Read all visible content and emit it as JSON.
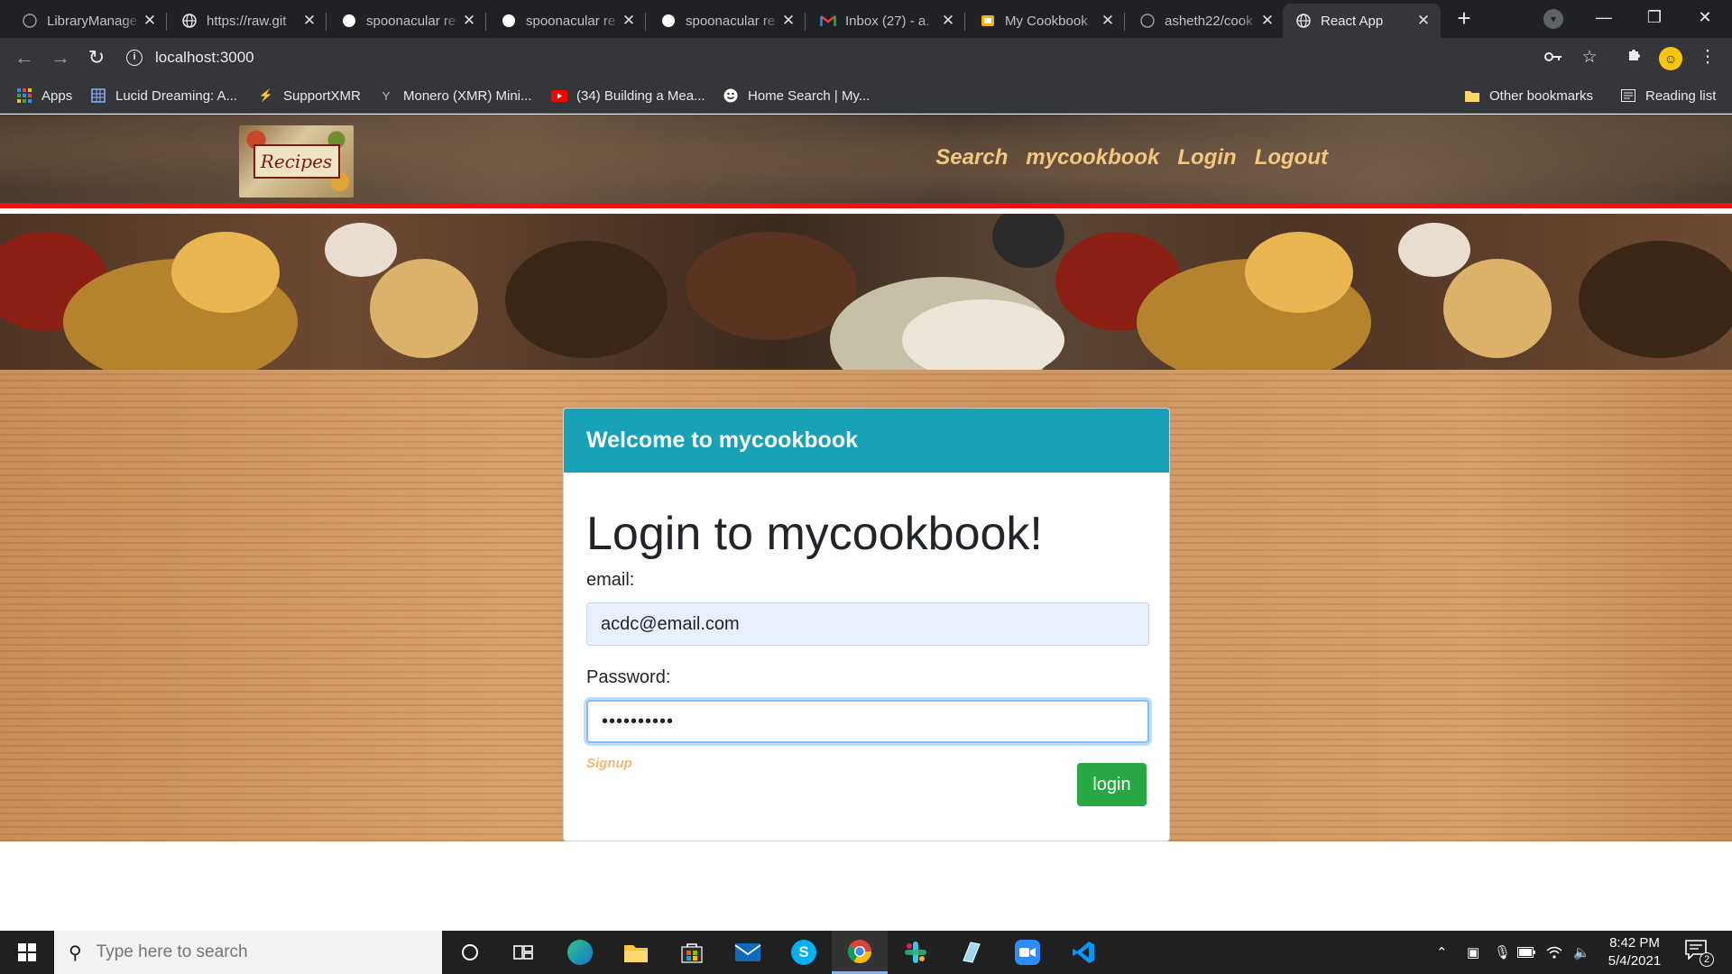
{
  "browser": {
    "tabs": [
      {
        "title": "LibraryManage",
        "icon": "github-icon"
      },
      {
        "title": "https://raw.git",
        "icon": "globe-icon"
      },
      {
        "title": "spoonacular re",
        "icon": "spoonacular-icon"
      },
      {
        "title": "spoonacular re",
        "icon": "spoonacular-icon"
      },
      {
        "title": "spoonacular re",
        "icon": "spoonacular-icon"
      },
      {
        "title": "Inbox (27) - a.",
        "icon": "gmail-icon"
      },
      {
        "title": "My Cookbook",
        "icon": "slides-icon"
      },
      {
        "title": "asheth22/cook",
        "icon": "github-icon"
      },
      {
        "title": "React App",
        "icon": "globe-icon",
        "active": true
      }
    ],
    "url": "localhost:3000",
    "bookmarks": [
      {
        "label": "Apps",
        "icon": "apps-grid-icon"
      },
      {
        "label": "Lucid Dreaming: A...",
        "icon": "grid-icon"
      },
      {
        "label": "SupportXMR",
        "icon": "bolt-icon"
      },
      {
        "label": "Monero (XMR) Mini...",
        "icon": "glass-icon"
      },
      {
        "label": "(34) Building a Mea...",
        "icon": "youtube-icon"
      },
      {
        "label": "Home Search | My...",
        "icon": "smiley-icon"
      }
    ],
    "other_bookmarks": "Other bookmarks",
    "reading_list": "Reading list"
  },
  "site": {
    "logo_text": "Recipes",
    "nav": [
      "Search",
      "mycookbook",
      "Login",
      "Logout"
    ]
  },
  "login_card": {
    "header": "Welcome to mycookbook",
    "title": "Login to mycookbook!",
    "email_label": "email:",
    "email_value": "acdc@email.com",
    "password_label": "Password:",
    "password_value": "••••••••••",
    "signup_link": "Signup",
    "login_button": "login"
  },
  "taskbar": {
    "search_placeholder": "Type here to search",
    "time": "8:42 PM",
    "date": "5/4/2021",
    "notification_count": "2"
  },
  "colors": {
    "card_header": "#17a2b8",
    "login_button": "#28a745",
    "nav_link": "#f5c77e",
    "header_border": "#ee1111"
  }
}
